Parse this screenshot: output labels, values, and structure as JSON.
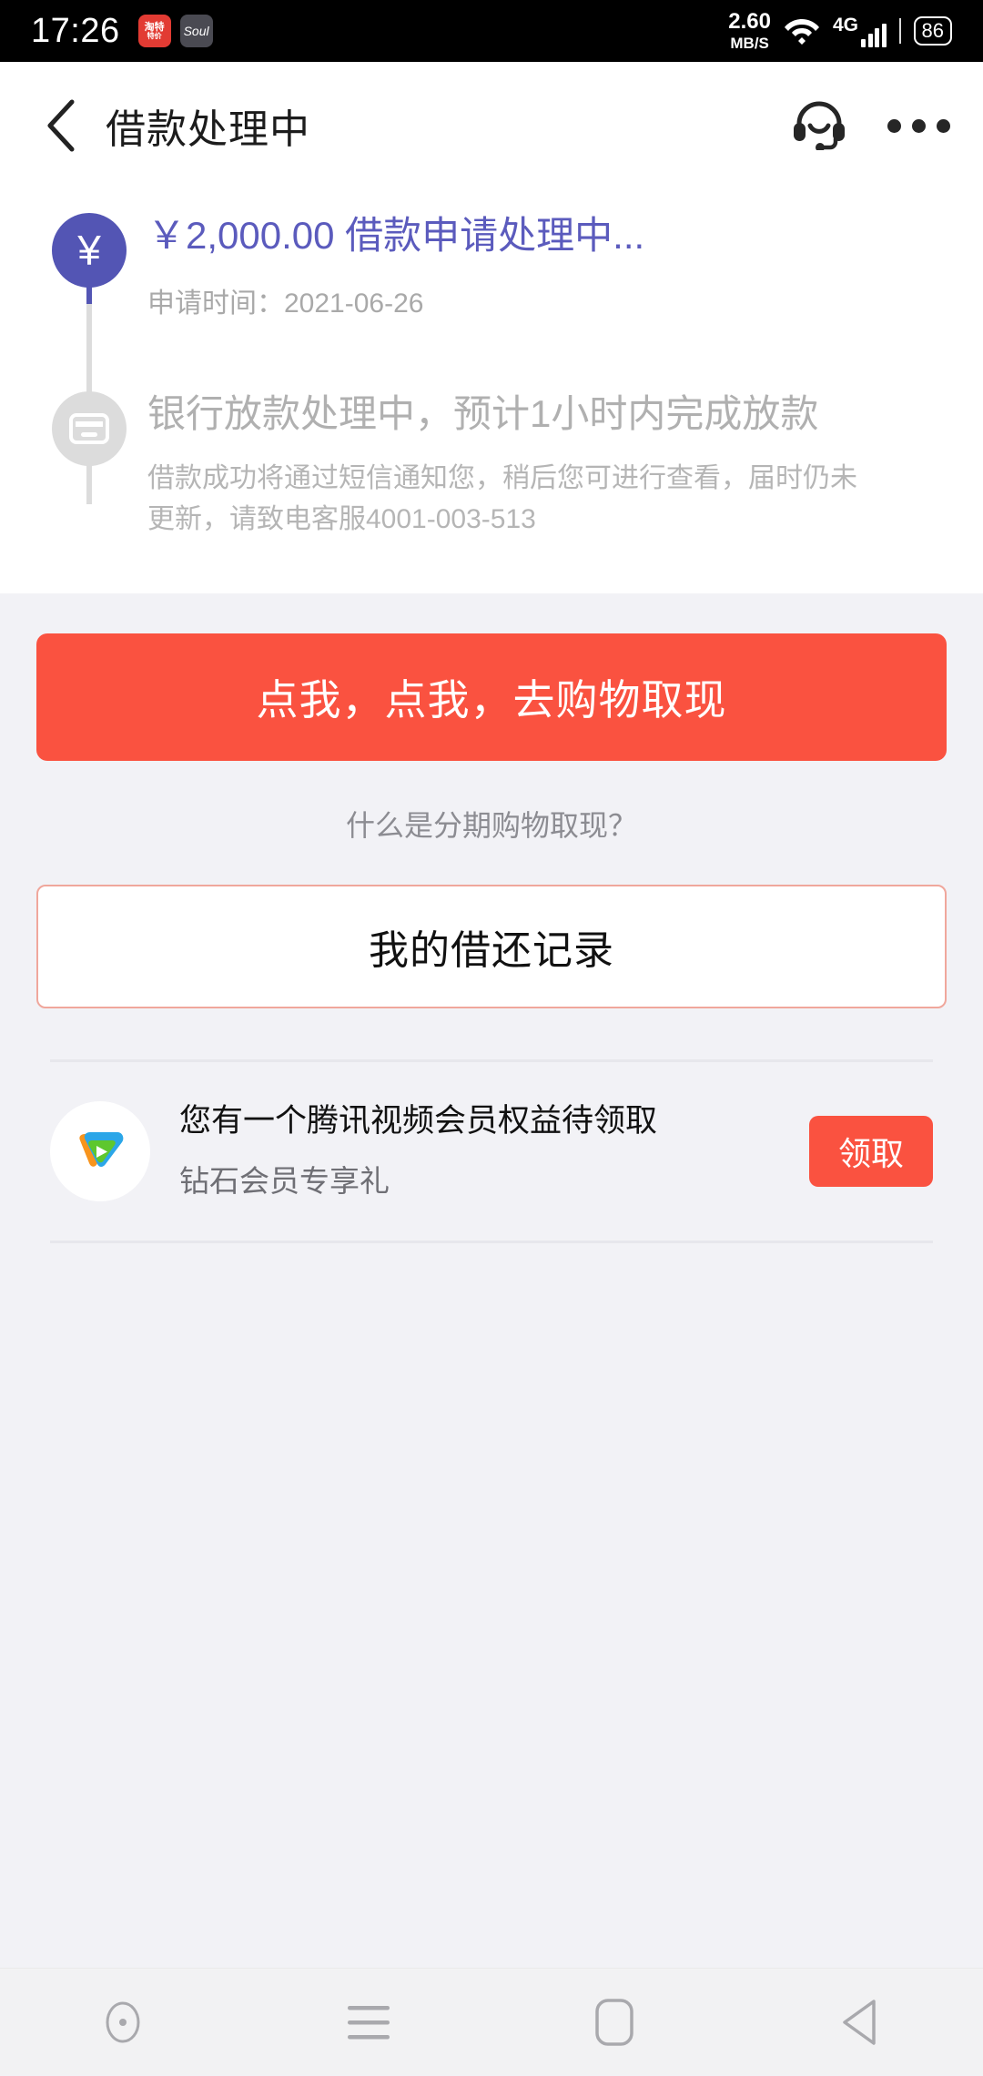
{
  "status_bar": {
    "time": "17:26",
    "apps": [
      {
        "name": "app-icon-red",
        "line1": "淘特",
        "line2": "特价"
      },
      {
        "name": "app-icon-soul",
        "label": "Soul"
      }
    ],
    "net_speed_value": "2.60",
    "net_speed_unit": "MB/S",
    "wifi_icon": "wifi-icon",
    "network_type": "4G",
    "battery": "86"
  },
  "navbar": {
    "back_icon": "back-chevron-icon",
    "title": "借款处理中",
    "support_icon": "headset-icon",
    "more_icon": "more-dots-icon"
  },
  "timeline": {
    "steps": [
      {
        "icon": "yen-icon",
        "icon_glyph": "¥",
        "state": "active",
        "title": "￥2,000.00 借款申请处理中...",
        "subtitle": "申请时间：2021-06-26"
      },
      {
        "icon": "bank-card-icon",
        "state": "pending",
        "title": "银行放款处理中，预计1小时内完成放款",
        "description": "借款成功将通过短信通知您，稍后您可进行查看，届时仍未更新，请致电客服4001-003-513"
      }
    ]
  },
  "actions": {
    "cta_label": "点我，点我，去购物取现",
    "help_link": "什么是分期购物取现？",
    "records_label": "我的借还记录"
  },
  "promo": {
    "logo_icon": "tencent-video-logo",
    "title": "您有一个腾讯视频会员权益待领取",
    "subtitle": "钻石会员专享礼",
    "button_label": "领取"
  },
  "system_nav": {
    "assistant_icon": "assistant-circle-icon",
    "menu_icon": "recents-menu-icon",
    "home_icon": "home-icon",
    "back_icon": "system-back-icon"
  },
  "colors": {
    "accent_purple": "#5355b4",
    "accent_red": "#fa5240",
    "page_bg": "#f2f2f6",
    "muted_text": "#b0b0b0"
  }
}
